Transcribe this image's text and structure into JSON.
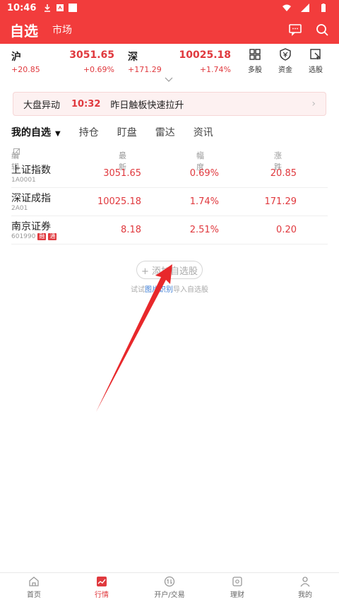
{
  "status_bar": {
    "time": "10:46"
  },
  "header": {
    "title": "自选",
    "subtitle": "市场"
  },
  "indices": [
    {
      "name": "沪",
      "price": "3051.65",
      "change": "+20.85",
      "percent": "+0.69%"
    },
    {
      "name": "深",
      "price": "10025.18",
      "change": "+171.29",
      "percent": "+1.74%"
    }
  ],
  "quick_actions": [
    {
      "label": "多股",
      "icon": "grid-icon"
    },
    {
      "label": "资金",
      "icon": "shield-yen-icon"
    },
    {
      "label": "选股",
      "icon": "cursor-select-icon"
    }
  ],
  "alert": {
    "label": "大盘异动",
    "time": "10:32",
    "message": "昨日触板快速拉升",
    "arrow": "›"
  },
  "tabs": [
    {
      "label": "我的自选",
      "active": true,
      "caret": "▼"
    },
    {
      "label": "持仓"
    },
    {
      "label": "盯盘"
    },
    {
      "label": "雷达"
    },
    {
      "label": "资讯"
    }
  ],
  "table": {
    "headers": {
      "edit": "编辑",
      "latest": "最新",
      "range": "幅度",
      "change": "涨跌"
    },
    "sort_glyph": "◇",
    "rows": [
      {
        "name": "上证指数",
        "code": "1A0001",
        "latest": "3051.65",
        "range": "0.69%",
        "change": "20.85"
      },
      {
        "name": "深证成指",
        "code": "2A01",
        "latest": "10025.18",
        "range": "1.74%",
        "change": "171.29"
      },
      {
        "name": "南京证券",
        "code": "601990",
        "badges": [
          "融",
          "通"
        ],
        "latest": "8.18",
        "range": "2.51%",
        "change": "0.20"
      }
    ]
  },
  "add_button": {
    "label": "+ 添加自选股"
  },
  "hint": {
    "before": "试试",
    "link": "图片识别",
    "after": "导入自选股"
  },
  "bottom_nav": [
    {
      "label": "首页",
      "icon": "home-icon"
    },
    {
      "label": "行情",
      "icon": "chart-icon",
      "active": true
    },
    {
      "label": "开户/交易",
      "icon": "exchange-icon"
    },
    {
      "label": "理财",
      "icon": "wallet-icon"
    },
    {
      "label": "我的",
      "icon": "user-icon"
    }
  ],
  "colors": {
    "brand": "#f23c3c",
    "up": "#e0393e",
    "link": "#3a7bd5",
    "nav_bg": "#ffffff"
  }
}
